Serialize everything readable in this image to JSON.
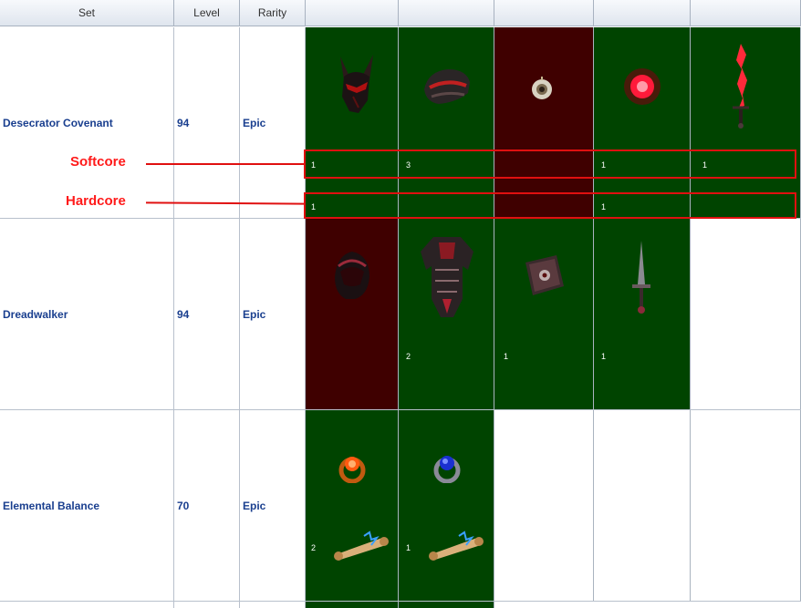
{
  "columns": {
    "set": "Set",
    "level": "Level",
    "rarity": "Rarity"
  },
  "rows": [
    {
      "set": "Desecrator Covenant",
      "level": "94",
      "rarity": "Epic",
      "items": [
        {
          "icon": "horned-helmet-icon",
          "state": "green",
          "softcore": "1",
          "hardcore": "1"
        },
        {
          "icon": "pauldron-icon",
          "state": "green",
          "softcore": "3",
          "hardcore": ""
        },
        {
          "icon": "amulet-icon",
          "state": "red",
          "softcore": "",
          "hardcore": ""
        },
        {
          "icon": "red-orb-icon",
          "state": "green",
          "softcore": "1",
          "hardcore": "1"
        },
        {
          "icon": "flaming-sword-icon",
          "state": "green",
          "softcore": "1",
          "hardcore": ""
        }
      ]
    },
    {
      "set": "Dreadwalker",
      "level": "94",
      "rarity": "Epic",
      "items": [
        {
          "icon": "hood-icon",
          "state": "red",
          "count": ""
        },
        {
          "icon": "chest-armor-icon",
          "state": "green",
          "count": "2"
        },
        {
          "icon": "tome-icon",
          "state": "green",
          "count": "1"
        },
        {
          "icon": "dagger-icon",
          "state": "green",
          "count": "1"
        }
      ]
    },
    {
      "set": "Elemental Balance",
      "level": "70",
      "rarity": "Epic",
      "items": [
        {
          "icon": "fire-ring-icon",
          "state": "green",
          "count": "2"
        },
        {
          "icon": "sapphire-ring-icon",
          "state": "green",
          "count": "1"
        }
      ]
    }
  ],
  "annotations": {
    "softcore": "Softcore",
    "hardcore": "Hardcore"
  },
  "colors": {
    "owned": "#004400",
    "missing": "#3f0000",
    "highlight": "#e01010",
    "link_text": "#1a3f8f"
  }
}
